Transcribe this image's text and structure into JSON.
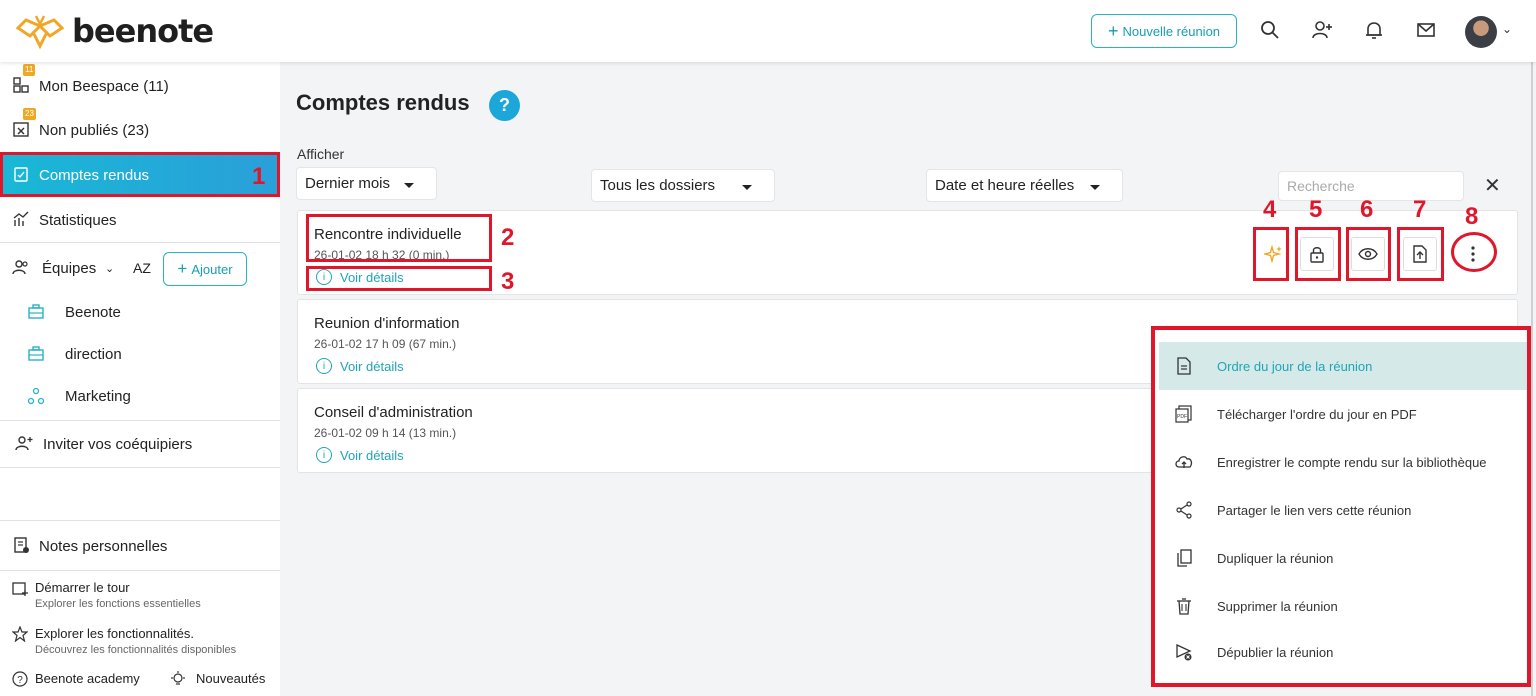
{
  "header": {
    "logo_text": "beenote",
    "new_meeting": "Nouvelle réunion",
    "icons": [
      "search-icon",
      "add-user-icon",
      "bell-icon",
      "mail-icon",
      "avatar",
      "chevron-down-icon"
    ]
  },
  "sidebar": {
    "items": [
      {
        "label": "Mon Beespace (11)",
        "badge": "11",
        "icon": "dashboard-icon"
      },
      {
        "label": "Non publiés (23)",
        "badge": "23",
        "icon": "calendar-x-icon"
      },
      {
        "label": "Comptes rendus",
        "icon": "clipboard-check-icon",
        "active": true
      },
      {
        "label": "Statistiques",
        "icon": "chart-icon"
      }
    ],
    "teams_label": "Équipes",
    "sort_label": "AZ",
    "add_label": "Ajouter",
    "teams": [
      {
        "label": "Beenote",
        "icon": "briefcase-icon"
      },
      {
        "label": "direction",
        "icon": "briefcase-icon"
      },
      {
        "label": "Marketing",
        "icon": "network-icon"
      }
    ],
    "invite": "Inviter vos coéquipiers",
    "personal_notes": "Notes personnelles",
    "tour": {
      "title": "Démarrer le tour",
      "subtitle": "Explorer les fonctions essentielles"
    },
    "explore": {
      "title": "Explorer les fonctionnalités.",
      "subtitle": "Découvrez les fonctionnalités disponibles"
    },
    "academy": "Beenote academy",
    "news": "Nouveautés"
  },
  "main": {
    "title": "Comptes rendus",
    "help": "?",
    "show_label": "Afficher",
    "filters": {
      "period": "Dernier mois",
      "folders": "Tous les dossiers",
      "date_mode": "Date et heure réelles"
    },
    "search_placeholder": "Recherche",
    "details_label": "Voir détails",
    "meetings": [
      {
        "title": "Rencontre individuelle",
        "date": "26-01-02 18 h 32 (0 min.)"
      },
      {
        "title": "Reunion d'information",
        "date": "26-01-02 17 h 09 (67 min.)"
      },
      {
        "title": "Conseil d'administration",
        "date": "26-01-02 09 h 14 (13 min.)"
      }
    ],
    "actions": [
      "ai-sparkle-icon",
      "lock-icon",
      "eye-icon",
      "export-icon",
      "more-vertical-icon"
    ]
  },
  "annotations": [
    "1",
    "2",
    "3",
    "4",
    "5",
    "6",
    "7",
    "8"
  ],
  "menu": {
    "items": [
      {
        "label": "Ordre du jour de la réunion",
        "icon": "document-icon",
        "active": true
      },
      {
        "label": "Télécharger l'ordre du jour en PDF",
        "icon": "pdf-icon"
      },
      {
        "label": "Enregistrer le compte rendu sur la bibliothèque",
        "icon": "cloud-upload-icon"
      },
      {
        "label": "Partager le lien vers cette réunion",
        "icon": "share-icon"
      },
      {
        "label": "Dupliquer la réunion",
        "icon": "copy-icon"
      },
      {
        "label": "Supprimer la réunion",
        "icon": "trash-icon"
      },
      {
        "label": "Dépublier la réunion",
        "icon": "unpublish-icon"
      }
    ]
  },
  "colors": {
    "accent": "#1fa5b5",
    "annotation": "#e0162b",
    "badge": "#f0a824",
    "active_gradient": "#19b8d6"
  }
}
